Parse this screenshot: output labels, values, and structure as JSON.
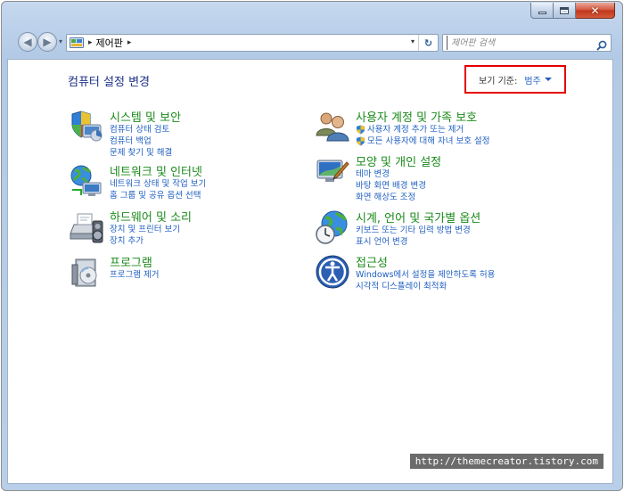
{
  "window": {
    "caption": {
      "minimize": "",
      "maximize": "",
      "close": "✕"
    }
  },
  "navigation": {
    "back_glyph": "◀",
    "forward_glyph": "▶",
    "recent_glyph": "▾",
    "address_separator": "▸",
    "address_text": "제어판",
    "address_trailing_separator": "▸",
    "address_dropdown": "▾",
    "refresh_glyph": "↻",
    "search_placeholder": "제어판 검색"
  },
  "page": {
    "title": "컴퓨터 설정 변경",
    "view_by_label": "보기 기준:",
    "view_by_value": "범주"
  },
  "categories": [
    {
      "icon": "system-security-icon",
      "title": "시스템 및 보안",
      "links": [
        "컴퓨터 상태 검토",
        "컴퓨터 백업",
        "문제 찾기 및 해결"
      ]
    },
    {
      "icon": "network-internet-icon",
      "title": "네트워크 및 인터넷",
      "links": [
        "네트워크 상태 및 작업 보기",
        "홈 그룹 및 공유 옵션 선택"
      ]
    },
    {
      "icon": "hardware-sound-icon",
      "title": "하드웨어 및 소리",
      "links": [
        "장치 및 프린터 보기",
        "장치 추가"
      ]
    },
    {
      "icon": "programs-icon",
      "title": "프로그램",
      "links": [
        "프로그램 제거"
      ]
    },
    {
      "icon": "user-accounts-icon",
      "title": "사용자 계정 및 가족 보호",
      "links": [
        "사용자 계정 추가 또는 제거",
        "모든 사용자에 대해 자녀 보호 설정"
      ]
    },
    {
      "icon": "appearance-personalization-icon",
      "title": "모양 및 개인 설정",
      "links": [
        "테마 변경",
        "바탕 화면 배경 변경",
        "화면 해상도 조정"
      ]
    },
    {
      "icon": "clock-language-region-icon",
      "title": "시계, 언어 및 국가별 옵션",
      "links": [
        "키보드 또는 기타 입력 방법 변경",
        "표시 언어 변경"
      ]
    },
    {
      "icon": "ease-of-access-icon",
      "title": "접근성",
      "links": [
        "Windows에서 설정을 제안하도록 허용",
        "시각적 디스플레이 최적화"
      ]
    }
  ],
  "watermark": "http://themecreator.tistory.com",
  "colors": {
    "category_title": "#1b8a1b",
    "link": "#1f5fc1",
    "page_title": "#1e3287",
    "highlight_box": "#e60000"
  }
}
